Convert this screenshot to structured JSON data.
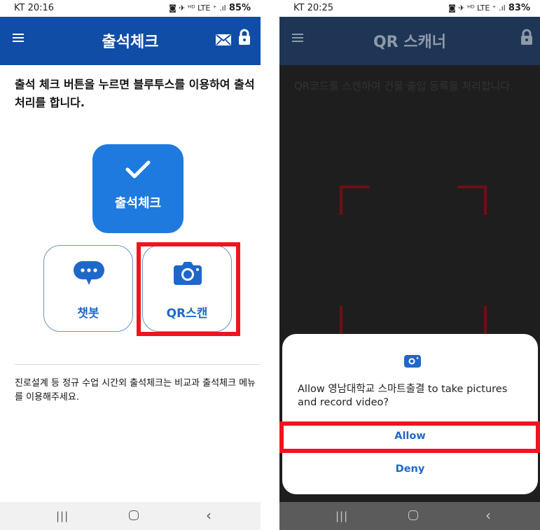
{
  "left_screen": {
    "status": {
      "time": "KT 20:16",
      "indicators": "◙ ✈ ᴴᴰ LTE ⁺ .ıl",
      "battery": "85%"
    },
    "app_bar": {
      "title": "출석체크",
      "icons": [
        "menu-icon",
        "mail-icon",
        "lock-icon"
      ]
    },
    "intro_text": "출석 체크 버튼을 누르면 블루투스를 이용하여 출석처리를 합니다.",
    "attend_button": {
      "label": "출석체크",
      "icon": "check-icon"
    },
    "chatbot_button": {
      "label": "챗봇",
      "icon": "chat-bubble-icon"
    },
    "qr_button": {
      "label": "QR스캔",
      "icon": "camera-icon"
    },
    "note_text": "진로설계 등 정규 수업 시간외 출석체크는 비교과 출석체크 메뉴를 이용해주세요.",
    "nav": {
      "recent": "|||",
      "back": "‹"
    }
  },
  "right_screen": {
    "status": {
      "time": "KT 20:25",
      "indicators": "◙ ✈ ᴴᴰ LTE ⁺ .ıl",
      "battery": "83%"
    },
    "app_bar": {
      "title": "QR 스캐너",
      "icons": [
        "menu-icon",
        "lock-icon"
      ]
    },
    "scanner_text": "QR코드를 스캔하여 건물 출입 등록을 처리합니다.",
    "dialog": {
      "icon": "camera-icon",
      "message": "Allow 영남대학교 스마트출결 to take pictures and record video?",
      "allow_label": "Allow",
      "deny_label": "Deny"
    },
    "nav": {
      "recent": "|||",
      "back": "‹"
    }
  },
  "colors": {
    "app_bar": "#0f4da6",
    "accent": "#1f7ae0",
    "highlight": "#f0141e",
    "scanner_corner": "#6e1014"
  }
}
